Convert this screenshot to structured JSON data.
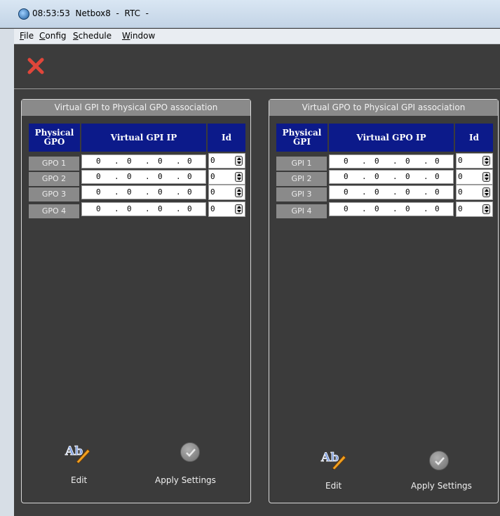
{
  "window": {
    "title": "08:53:53  Netbox8  -  RTC  -"
  },
  "menu": [
    {
      "label": "File",
      "mnemonic": "F",
      "rest": "ile"
    },
    {
      "label": "Config",
      "mnemonic": "C",
      "rest": "onfig"
    },
    {
      "label": "Schedule",
      "mnemonic": "S",
      "rest": "chedule"
    },
    {
      "label": "Window",
      "mnemonic": "W",
      "rest": "indow"
    }
  ],
  "toolbar": {
    "close_icon": "red-x-icon",
    "close_color": "#e0463a"
  },
  "colors": {
    "header_bg": "#0c1a8a",
    "label_bg": "#8a8a8a",
    "panel_bg": "#3b3b3b"
  },
  "left_panel": {
    "title": "Virtual GPI to Physical GPO association",
    "col_physical": "Physical\nGPO",
    "col_virtual": "Virtual  GPI  IP",
    "col_id": "Id",
    "rows": [
      {
        "label": "GPO 1",
        "ip": [
          "0",
          "0",
          "0",
          "0"
        ],
        "id": "0"
      },
      {
        "label": "GPO 2",
        "ip": [
          "0",
          "0",
          "0",
          "0"
        ],
        "id": "0"
      },
      {
        "label": "GPO 3",
        "ip": [
          "0",
          "0",
          "0",
          "0"
        ],
        "id": "0"
      },
      {
        "label": "GPO 4",
        "ip": [
          "0",
          "0",
          "0",
          "0"
        ],
        "id": "0"
      }
    ],
    "edit_label": "Edit",
    "apply_label": "Apply Settings"
  },
  "right_panel": {
    "title": "Virtual GPO to Physical GPI association",
    "col_physical": "Physical\nGPI",
    "col_virtual": "Virtual  GPO  IP",
    "col_id": "Id",
    "rows": [
      {
        "label": "GPI 1",
        "ip": [
          "0",
          "0",
          "0",
          "0"
        ],
        "id": "0"
      },
      {
        "label": "GPI 2",
        "ip": [
          "0",
          "0",
          "0",
          "0"
        ],
        "id": "0"
      },
      {
        "label": "GPI 3",
        "ip": [
          "0",
          "0",
          "0",
          "0"
        ],
        "id": "0"
      },
      {
        "label": "GPI 4",
        "ip": [
          "0",
          "0",
          "0",
          "0"
        ],
        "id": "0"
      }
    ],
    "edit_label": "Edit",
    "apply_label": "Apply Settings"
  }
}
